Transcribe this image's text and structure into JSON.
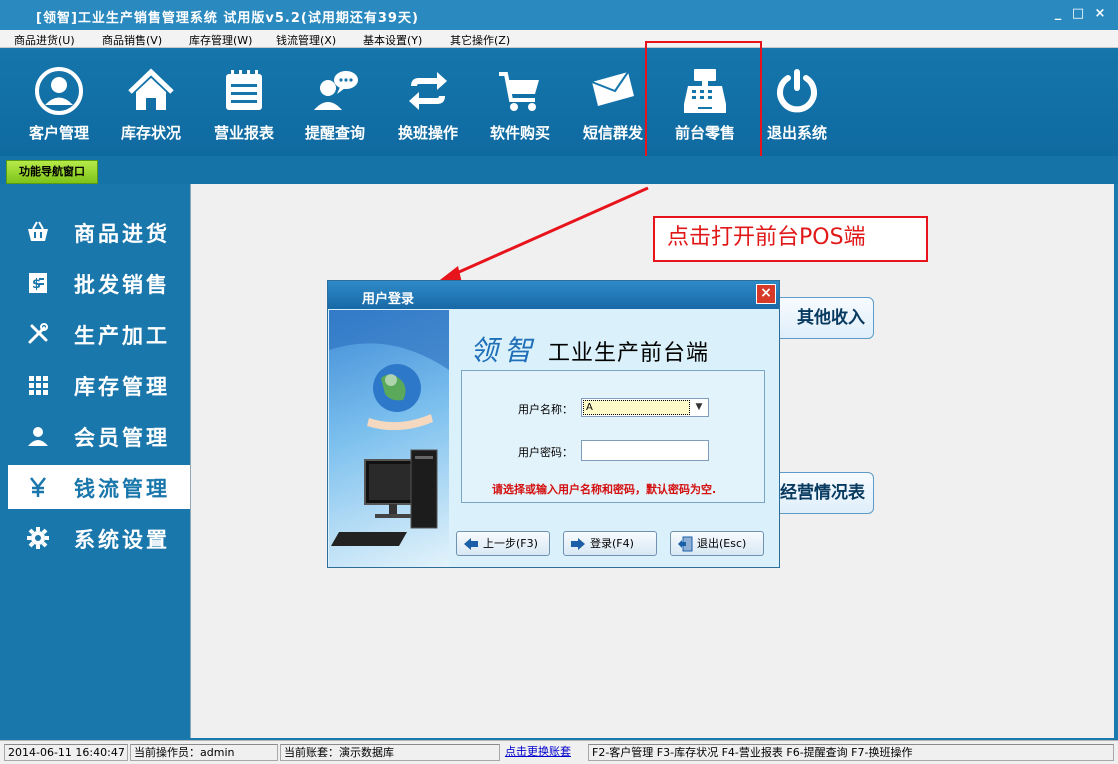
{
  "window": {
    "title": "[领智]工业生产销售管理系统 试用版v5.2(试用期还有39天)",
    "controls": [
      "_",
      "□",
      "×"
    ]
  },
  "menu": [
    "商品进货(U)",
    "商品销售(V)",
    "库存管理(W)",
    "钱流管理(X)",
    "基本设置(Y)",
    "其它操作(Z)"
  ],
  "toolbar": [
    {
      "label": "客户管理",
      "icon": "person-icon"
    },
    {
      "label": "库存状况",
      "icon": "home-icon"
    },
    {
      "label": "营业报表",
      "icon": "report-icon"
    },
    {
      "label": "提醒查询",
      "icon": "chat-users-icon"
    },
    {
      "label": "换班操作",
      "icon": "swap-icon"
    },
    {
      "label": "软件购买",
      "icon": "cart-icon"
    },
    {
      "label": "短信群发",
      "icon": "mail-icon"
    },
    {
      "label": "前台零售",
      "icon": "cash-register-icon"
    },
    {
      "label": "退出系统",
      "icon": "power-icon"
    }
  ],
  "tab": {
    "label": "功能导航窗口"
  },
  "sidebar": [
    {
      "label": "商品进货",
      "icon": "basket-icon",
      "active": false
    },
    {
      "label": "批发销售",
      "icon": "invoice-icon",
      "active": false
    },
    {
      "label": "生产加工",
      "icon": "tools-icon",
      "active": false
    },
    {
      "label": "库存管理",
      "icon": "grid-icon",
      "active": false
    },
    {
      "label": "会员管理",
      "icon": "member-icon",
      "active": false
    },
    {
      "label": "钱流管理",
      "icon": "yen-icon",
      "active": true
    },
    {
      "label": "系统设置",
      "icon": "gear-icon",
      "active": false
    }
  ],
  "content_buttons": {
    "other_income": "其他收入",
    "business_status": "经营情况表"
  },
  "callout": {
    "text": "点击打开前台POS端",
    "color": "#e01818"
  },
  "dialog": {
    "title": "用户登录",
    "close": "×",
    "brand_script": "领智",
    "brand_name": "工业生产前台端",
    "username_label": "用户名称：",
    "username_value": "A",
    "password_label": "用户密码：",
    "hint": "请选择或输入用户名称和密码，默认密码为空.",
    "buttons": {
      "prev": "上一步(F3)",
      "login": "登录(F4)",
      "exit": "退出(Esc)"
    }
  },
  "statusbar": {
    "datetime": "2014-06-11 16:40:47",
    "operator": "当前操作员：admin",
    "account": "当前账套：演示数据库",
    "switch_link": "点击更换账套",
    "shortcuts": "F2-客户管理 F3-库存状况 F4-营业报表 F6-提醒查询 F7-换班操作"
  },
  "colors": {
    "primary_blue": "#1a77ab",
    "accent_red": "#e8141c",
    "tab_green": "#7cc318"
  }
}
